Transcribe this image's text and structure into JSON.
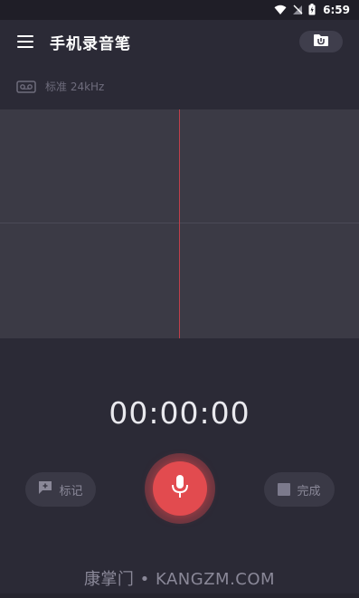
{
  "status_bar": {
    "time": "6:59",
    "icons": [
      "wifi-icon",
      "signal-off-icon",
      "battery-charging-icon"
    ]
  },
  "app_bar": {
    "menu_icon": "menu-icon",
    "title": "手机录音笔",
    "folder_icon": "folder-icon"
  },
  "quality": {
    "icon": "cassette-icon",
    "label": "标准 24kHz"
  },
  "timer": "00:00:00",
  "controls": {
    "mark_label": "标记",
    "mark_icon": "flag-plus-icon",
    "record_icon": "microphone-icon",
    "done_label": "完成",
    "done_icon": "stop-square-icon"
  },
  "watermark": "康掌门 • KANGZM.COM",
  "colors": {
    "background": "#2b2a36",
    "waveform_bg": "#3b3a45",
    "playhead": "#c0404a",
    "record_red": "#e24b4f"
  }
}
